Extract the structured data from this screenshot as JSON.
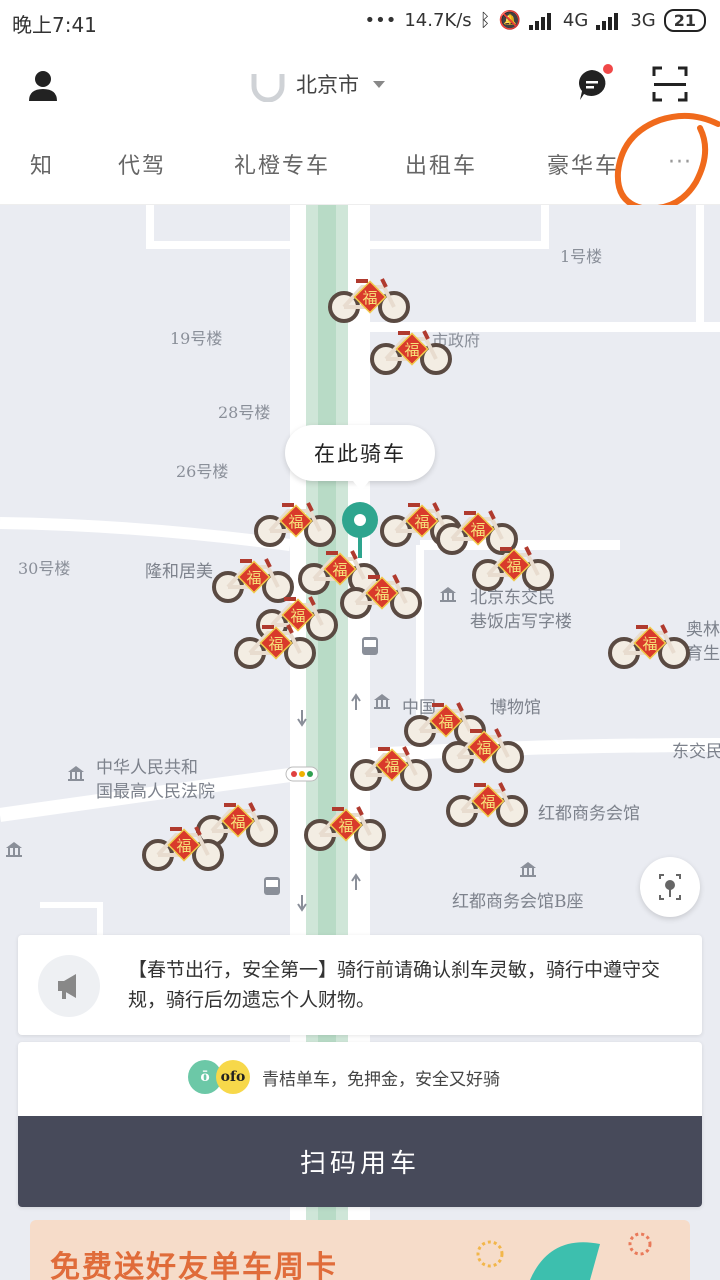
{
  "status_bar": {
    "time": "晚上7:41",
    "net_speed": "14.7K/s",
    "network_1": "4G",
    "network_2": "3G",
    "battery": "21"
  },
  "header": {
    "city": "北京市",
    "user_icon": "user-icon",
    "message_icon": "chat-bubble-icon",
    "scan_icon": "scan-qr-icon"
  },
  "tabs": [
    {
      "label": "知"
    },
    {
      "label": "代驾"
    },
    {
      "label": "礼橙专车"
    },
    {
      "label": "出租车"
    },
    {
      "label": "豪华车"
    }
  ],
  "tabs_more": "···",
  "map": {
    "ride_here_label": "在此骑车",
    "labels": [
      {
        "text": "1号楼"
      },
      {
        "text": "19号楼"
      },
      {
        "text": "市政府"
      },
      {
        "text": "28号楼"
      },
      {
        "text": "26号楼"
      },
      {
        "text": "30号楼"
      },
      {
        "text": "隆和居美"
      },
      {
        "text": "北京东交民"
      },
      {
        "text": "巷饭店写字楼"
      },
      {
        "text": "奥林"
      },
      {
        "text": "育生"
      },
      {
        "text": "中国"
      },
      {
        "text": "博物馆"
      },
      {
        "text": "中华人民共和"
      },
      {
        "text": "国最高人民法院"
      },
      {
        "text": "东交民"
      },
      {
        "text": "红都商务会馆"
      },
      {
        "text": "红都商务会馆B座"
      }
    ],
    "bike_badge": "福"
  },
  "notice": {
    "text": "【春节出行，安全第一】骑行前请确认刹车灵敏，骑行中遵守交规，骑行后勿遗忘个人财物。"
  },
  "bike_service": {
    "brand_text": "青桔单车，免押金，安全又好骑",
    "ofo_label": "ofo",
    "scan_button": "扫码用车"
  },
  "promo": {
    "title": "免费送好友单车周卡"
  },
  "colors": {
    "accent_green": "#2ea58e",
    "button_dark": "#474a5a",
    "annotation_orange": "#f06a1c",
    "bike_red": "#d93a2b"
  }
}
